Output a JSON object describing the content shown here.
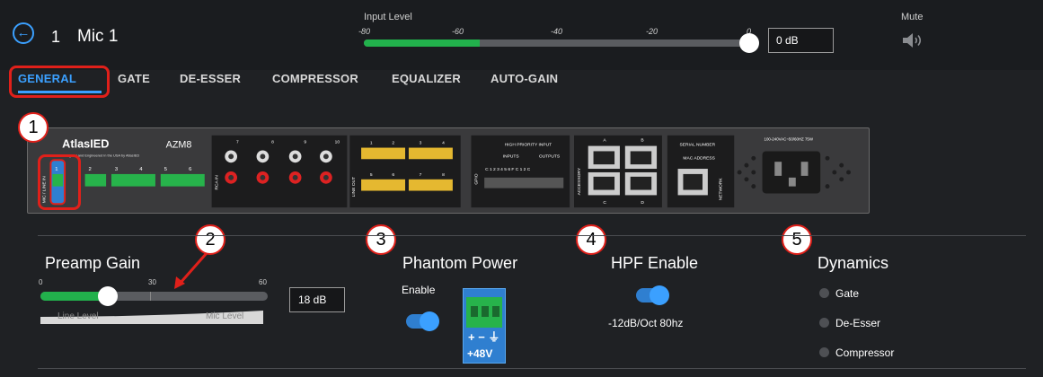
{
  "header": {
    "channel_number": "1",
    "channel_name": "Mic 1",
    "input_level": {
      "title": "Input Level",
      "ticks": [
        "-80",
        "-60",
        "-40",
        "-20",
        "0"
      ],
      "level_db": -56,
      "value": "0 dB"
    },
    "mute": {
      "label": "Mute",
      "icon": "speaker-icon",
      "muted": false
    }
  },
  "tabs": [
    "GENERAL",
    "GATE",
    "DE-ESSER",
    "COMPRESSOR",
    "EQUALIZER",
    "AUTO-GAIN"
  ],
  "active_tab": "GENERAL",
  "callouts": [
    "1",
    "2",
    "3",
    "4",
    "5"
  ],
  "device": {
    "brand": "AtlasIED",
    "model": "AZM8",
    "tagline": "Designed and Engineered in the USA by AtlasIED",
    "mic_line_label": "MIC / LINE IN",
    "mic_inputs": [
      "1",
      "2",
      "3",
      "4",
      "5",
      "6"
    ],
    "rca_label": "RCA IN",
    "rca_channels": [
      "7",
      "8",
      "9",
      "10"
    ],
    "line_out_label": "LINE OUT",
    "line_out_top": [
      "1",
      "2",
      "3",
      "4"
    ],
    "line_out_bottom": [
      "5",
      "6",
      "7",
      "8"
    ],
    "gpio_label": "GPIO",
    "high_priority_label": "HIGH PRIORITY INPUT",
    "inputs_label": "INPUTS",
    "outputs_label": "OUTPUTS",
    "gpio_pins": "C 1 2 3 4 5 6 F C 1 2 C",
    "accessory_label": "ACCESSORY",
    "accessory_ports": [
      "A",
      "B",
      "C",
      "D"
    ],
    "serial_label": "SERIAL NUMBER",
    "mac_label": "MAC ADDRESS",
    "network_label": "NETWORK",
    "power_label": "100-240VAC~50/60HZ 75W"
  },
  "preamp": {
    "title": "Preamp Gain",
    "ticks": [
      "0",
      "30",
      "60"
    ],
    "gain_db": 18,
    "range": [
      0,
      60
    ],
    "value": "18 dB",
    "line_label": "Line Level",
    "mic_label": "Mic Level"
  },
  "phantom": {
    "title": "Phantom Power",
    "enable_label": "Enable",
    "enabled": true,
    "connector_symbols": "+ − ⏚",
    "voltage_label": "+48V"
  },
  "hpf": {
    "title": "HPF Enable",
    "enabled": true,
    "description": "-12dB/Oct 80hz"
  },
  "dynamics": {
    "title": "Dynamics",
    "items": [
      "Gate",
      "De-Esser",
      "Compressor"
    ]
  },
  "colors": {
    "accent": "#3ba0ff",
    "meter_green": "#22b14c",
    "callout_red": "#e0201a"
  }
}
